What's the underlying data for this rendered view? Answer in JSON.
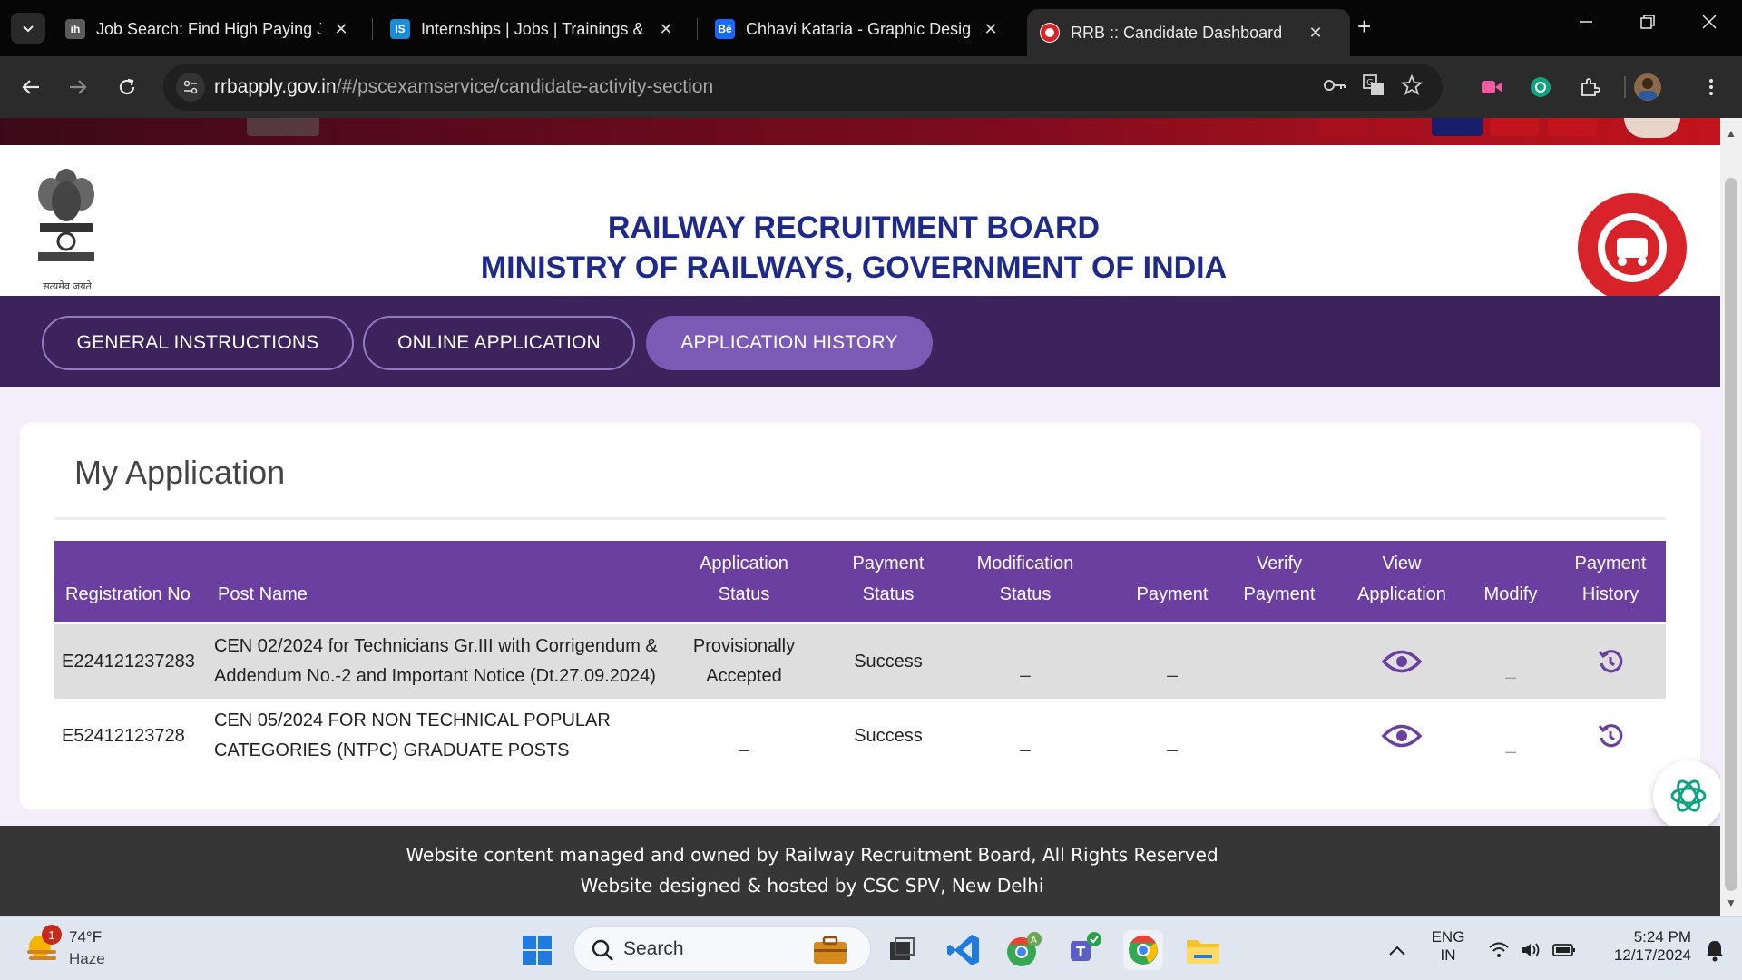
{
  "browser": {
    "tabs": [
      {
        "label": "Job Search: Find High Paying Jo",
        "favicon": "ih",
        "favicon_color": "#5a5a5a"
      },
      {
        "label": "Internships | Jobs | Trainings & I",
        "favicon": "IS",
        "favicon_color": "#1a8cd8"
      },
      {
        "label": "Chhavi Kataria - Graphic Design",
        "favicon": "Bē",
        "favicon_color": "#1769ff"
      },
      {
        "label": "RRB :: Candidate Dashboard",
        "favicon": "rrb-icon",
        "favicon_color": "#d8232a"
      }
    ],
    "url_host": "rrbapply.gov.in",
    "url_path": "/#/pscexamservice/candidate-activity-section"
  },
  "header": {
    "emblem_caption": "सत्यमेव जयते",
    "title_line1": "RAILWAY RECRUITMENT BOARD",
    "title_line2": "MINISTRY OF RAILWAYS, GOVERNMENT OF INDIA",
    "title_color": "#1d2a8a"
  },
  "nav": {
    "tabs": [
      {
        "label": "GENERAL INSTRUCTIONS"
      },
      {
        "label": "ONLINE APPLICATION"
      },
      {
        "label": "APPLICATION HISTORY"
      }
    ],
    "active_tab": "APPLICATION HISTORY",
    "accent": "#7b5bb5"
  },
  "main": {
    "title": "My Application",
    "table": {
      "header_color": "#6b3fa0",
      "columns": [
        {
          "line1": "",
          "line2": "Registration No"
        },
        {
          "line1": "",
          "line2": "Post Name"
        },
        {
          "line1": "Application",
          "line2": "Status"
        },
        {
          "line1": "Payment",
          "line2": "Status"
        },
        {
          "line1": "Modification",
          "line2": "Status"
        },
        {
          "line1": "",
          "line2": "Payment"
        },
        {
          "line1": "Verify",
          "line2": "Payment"
        },
        {
          "line1": "View",
          "line2": "Application"
        },
        {
          "line1": "",
          "line2": "Modify"
        },
        {
          "line1": "Payment",
          "line2": "History"
        }
      ],
      "rows": [
        {
          "registration_no": "E224121237283",
          "post_name_line1": "CEN 02/2024 for Technicians Gr.III with Corrigendum &",
          "post_name_line2": "Addendum No.-2 and Important Notice (Dt.27.09.2024)",
          "app_status_line1": "Provisionally",
          "app_status_line2": "Accepted",
          "payment_status": "Success",
          "modification_status": "_",
          "payment": "_",
          "modify": "_"
        },
        {
          "registration_no": "E52412123728",
          "post_name_line1": "CEN 05/2024 FOR NON TECHNICAL POPULAR",
          "post_name_line2": "CATEGORIES (NTPC) GRADUATE POSTS",
          "app_status_line1": "_",
          "app_status_line2": "",
          "payment_status": "Success",
          "modification_status": "_",
          "payment": "_",
          "modify": "_"
        }
      ]
    }
  },
  "footer": {
    "line1": "Website content managed and owned by Railway Recruitment Board, All Rights Reserved",
    "line2": "Website designed & hosted by CSC SPV, New Delhi"
  },
  "taskbar": {
    "weather_temp": "74°F",
    "weather_desc": "Haze",
    "weather_badge": "1",
    "search_placeholder": "Search",
    "lang_line1": "ENG",
    "lang_line2": "IN",
    "time": "5:24 PM",
    "date": "12/17/2024"
  }
}
